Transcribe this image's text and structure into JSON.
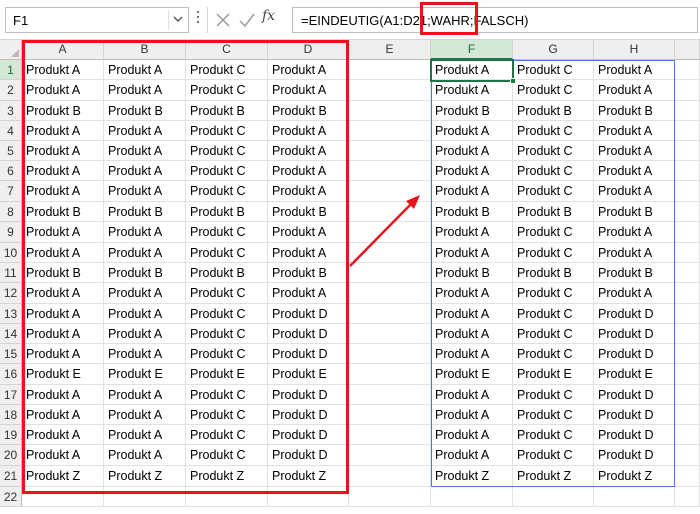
{
  "name_box": {
    "value": "F1"
  },
  "formula": {
    "fx_label": "fx",
    "text": "=EINDEUTIG(A1:D21;WAHR;FALSCH)"
  },
  "columns": [
    "A",
    "B",
    "C",
    "D",
    "E",
    "F",
    "G",
    "H"
  ],
  "rows": [
    "1",
    "2",
    "3",
    "4",
    "5",
    "6",
    "7",
    "8",
    "9",
    "10",
    "11",
    "12",
    "13",
    "14",
    "15",
    "16",
    "17",
    "18",
    "19",
    "20",
    "21",
    "22"
  ],
  "source": [
    [
      "Produkt A",
      "Produkt A",
      "Produkt C",
      "Produkt A"
    ],
    [
      "Produkt A",
      "Produkt A",
      "Produkt C",
      "Produkt A"
    ],
    [
      "Produkt B",
      "Produkt B",
      "Produkt B",
      "Produkt B"
    ],
    [
      "Produkt A",
      "Produkt A",
      "Produkt C",
      "Produkt A"
    ],
    [
      "Produkt A",
      "Produkt A",
      "Produkt C",
      "Produkt A"
    ],
    [
      "Produkt A",
      "Produkt A",
      "Produkt C",
      "Produkt A"
    ],
    [
      "Produkt A",
      "Produkt A",
      "Produkt C",
      "Produkt A"
    ],
    [
      "Produkt B",
      "Produkt B",
      "Produkt B",
      "Produkt B"
    ],
    [
      "Produkt A",
      "Produkt A",
      "Produkt C",
      "Produkt A"
    ],
    [
      "Produkt A",
      "Produkt A",
      "Produkt C",
      "Produkt A"
    ],
    [
      "Produkt B",
      "Produkt B",
      "Produkt B",
      "Produkt B"
    ],
    [
      "Produkt A",
      "Produkt A",
      "Produkt C",
      "Produkt A"
    ],
    [
      "Produkt A",
      "Produkt A",
      "Produkt C",
      "Produkt D"
    ],
    [
      "Produkt A",
      "Produkt A",
      "Produkt C",
      "Produkt D"
    ],
    [
      "Produkt A",
      "Produkt A",
      "Produkt C",
      "Produkt D"
    ],
    [
      "Produkt E",
      "Produkt E",
      "Produkt E",
      "Produkt E"
    ],
    [
      "Produkt A",
      "Produkt A",
      "Produkt C",
      "Produkt D"
    ],
    [
      "Produkt A",
      "Produkt A",
      "Produkt C",
      "Produkt D"
    ],
    [
      "Produkt A",
      "Produkt A",
      "Produkt C",
      "Produkt D"
    ],
    [
      "Produkt A",
      "Produkt A",
      "Produkt C",
      "Produkt D"
    ],
    [
      "Produkt Z",
      "Produkt Z",
      "Produkt Z",
      "Produkt Z"
    ]
  ],
  "result": [
    [
      "Produkt A",
      "Produkt C",
      "Produkt A"
    ],
    [
      "Produkt A",
      "Produkt C",
      "Produkt A"
    ],
    [
      "Produkt B",
      "Produkt B",
      "Produkt B"
    ],
    [
      "Produkt A",
      "Produkt C",
      "Produkt A"
    ],
    [
      "Produkt A",
      "Produkt C",
      "Produkt A"
    ],
    [
      "Produkt A",
      "Produkt C",
      "Produkt A"
    ],
    [
      "Produkt A",
      "Produkt C",
      "Produkt A"
    ],
    [
      "Produkt B",
      "Produkt B",
      "Produkt B"
    ],
    [
      "Produkt A",
      "Produkt C",
      "Produkt A"
    ],
    [
      "Produkt A",
      "Produkt C",
      "Produkt A"
    ],
    [
      "Produkt B",
      "Produkt B",
      "Produkt B"
    ],
    [
      "Produkt A",
      "Produkt C",
      "Produkt A"
    ],
    [
      "Produkt A",
      "Produkt C",
      "Produkt D"
    ],
    [
      "Produkt A",
      "Produkt C",
      "Produkt D"
    ],
    [
      "Produkt A",
      "Produkt C",
      "Produkt D"
    ],
    [
      "Produkt E",
      "Produkt E",
      "Produkt E"
    ],
    [
      "Produkt A",
      "Produkt C",
      "Produkt D"
    ],
    [
      "Produkt A",
      "Produkt C",
      "Produkt D"
    ],
    [
      "Produkt A",
      "Produkt C",
      "Produkt D"
    ],
    [
      "Produkt A",
      "Produkt C",
      "Produkt D"
    ],
    [
      "Produkt Z",
      "Produkt Z",
      "Produkt Z"
    ]
  ],
  "colors": {
    "annotation_red": "#e8141b",
    "selection_green": "#217346",
    "spill_blue": "#4a7fd1"
  },
  "icons": {
    "cancel": "x-icon",
    "enter": "check-icon",
    "function": "fx-icon",
    "dropdown": "chevron-down-icon"
  }
}
